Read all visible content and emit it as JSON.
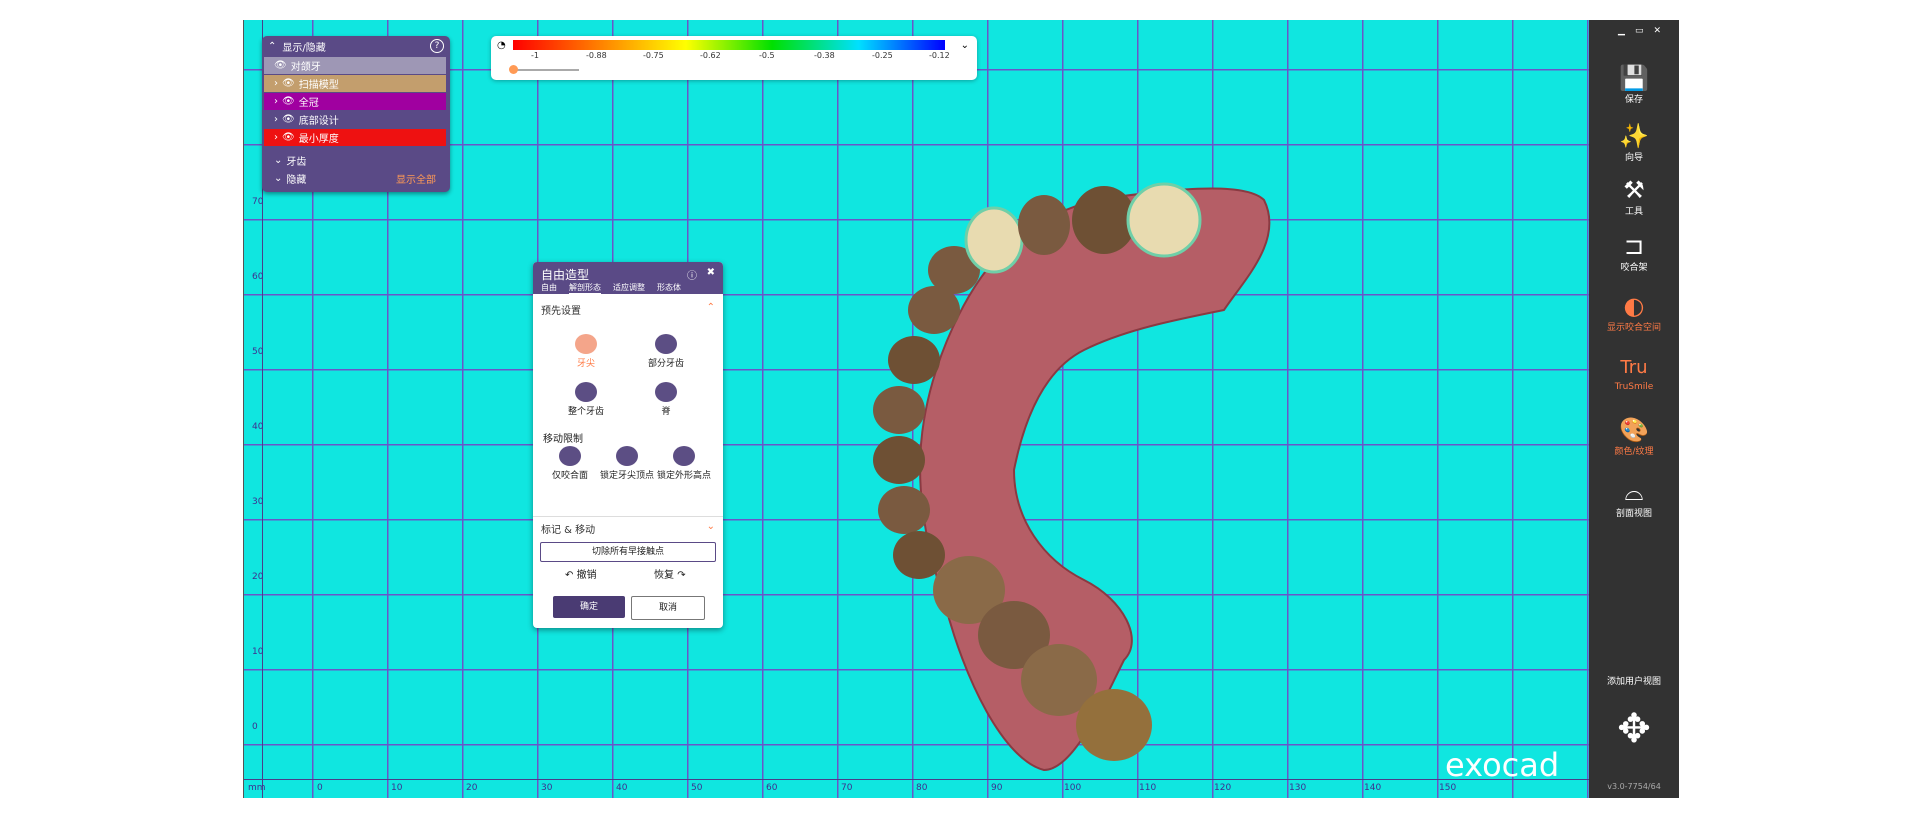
{
  "show_hide_panel": {
    "title": "显示/隐藏",
    "rows": [
      {
        "label": "对颌牙",
        "color": "#9e97b5"
      },
      {
        "label": "扫描模型",
        "color": "#c39e6d"
      },
      {
        "label": "全冠",
        "color": "#a000a0"
      },
      {
        "label": "底部设计",
        "color": "#5a4a86"
      },
      {
        "label": "最小厚度",
        "color": "#ee1111"
      }
    ],
    "teeth": "牙齿",
    "hidden": "隐藏",
    "show_all": "显示全部"
  },
  "color_scale": {
    "ticks": [
      "-1",
      "-0.88",
      "-0.75",
      "-0.62",
      "-0.5",
      "-0.38",
      "-0.25",
      "-0.12"
    ]
  },
  "freeform": {
    "title": "自由造型",
    "tabs": [
      "自由",
      "解剖形态",
      "适应调整",
      "形态体"
    ],
    "presets_title": "预先设置",
    "tools": [
      "牙尖",
      "部分牙齿",
      "整个牙齿",
      "脊"
    ],
    "move_limit": "移动限制",
    "limits": [
      "仅咬合面",
      "锁定牙尖顶点",
      "锁定外形高点"
    ],
    "mark_move": "标记 & 移动",
    "cut_contacts": "切除所有早接触点",
    "undo": "撤销",
    "redo": "恢复",
    "ok": "确定",
    "cancel": "取消"
  },
  "right_toolbar": {
    "items": [
      {
        "label": "保存",
        "icon": "save-icon",
        "color": "#ffffff"
      },
      {
        "label": "向导",
        "icon": "wizard-icon",
        "color": "#ffffff"
      },
      {
        "label": "工具",
        "icon": "tools-icon",
        "color": "#ffffff"
      },
      {
        "label": "咬合架",
        "icon": "articulator-icon",
        "color": "#ffffff"
      },
      {
        "label": "显示咬合空间",
        "icon": "bite-space-icon",
        "color": "#ff7a45"
      },
      {
        "label": "TruSmile",
        "icon": "trusmile-icon",
        "color": "#ff7a45"
      },
      {
        "label": "颜色/纹理",
        "icon": "palette-icon",
        "color": "#ff7a45"
      },
      {
        "label": "剖面视图",
        "icon": "section-view-icon",
        "color": "#ffffff"
      }
    ],
    "add_view": "添加用户视图",
    "version": "v3.0-7754/64"
  },
  "logo": "exocad",
  "ruler": {
    "unit": "mm",
    "y_labels": [
      "70",
      "60",
      "50",
      "40",
      "30",
      "20",
      "10",
      "0"
    ],
    "x_labels": [
      "0",
      "10",
      "20",
      "30",
      "40",
      "50",
      "60",
      "70",
      "80",
      "90",
      "100",
      "110",
      "120",
      "130",
      "140",
      "150"
    ]
  }
}
